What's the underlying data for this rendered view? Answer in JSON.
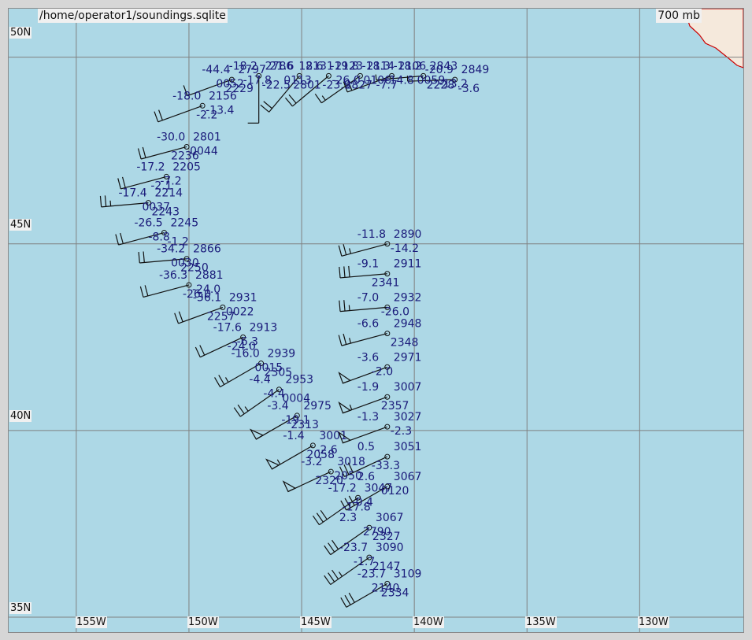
{
  "map": {
    "source_path": "/home/operator1/soundings.sqlite",
    "pressure_level": "700 mb",
    "colors": {
      "ocean": "#add8e6",
      "land": "#f5e9dc",
      "coast": "#cc0000",
      "grid": "#808080",
      "station_text": "#1a1a7a",
      "barb": "#111111"
    },
    "lat_labels": [
      "50N",
      "45N",
      "40N",
      "35N"
    ],
    "lon_labels": [
      "155W",
      "150W",
      "145W",
      "140W",
      "135W",
      "130W"
    ]
  },
  "chart_data": {
    "type": "scatter",
    "projection": "equirectangular",
    "lon_range": [
      -158,
      -125.4
    ],
    "lat_range": [
      34.6,
      51.3
    ],
    "grid": true,
    "lat_lines": [
      50,
      45,
      40,
      35
    ],
    "lon_lines": [
      -155,
      -150,
      -145,
      -140,
      -135,
      -130
    ],
    "stations": [
      {
        "lon": -146.9,
        "lat": 49.5,
        "temp": "-18.2",
        "hgt": "2786",
        "wind_dir": 180,
        "wind_kt": 10
      },
      {
        "lon": -145.1,
        "lat": 49.5,
        "temp": "21.6",
        "hgt": "2131",
        "wind_dir": 220,
        "wind_kt": 20
      },
      {
        "lon": -143.8,
        "lat": 49.5,
        "temp": "18.6",
        "hgt": "2123",
        "wind_dir": 230,
        "wind_kt": 20
      },
      {
        "lon": -142.4,
        "lat": 49.5,
        "temp": "-19.8",
        "hgt": "2114",
        "wind_dir": 235,
        "wind_kt": 15
      },
      {
        "lon": -141.0,
        "lat": 49.5,
        "temp": "-18.3",
        "hgt": "2106",
        "wind_dir": 250,
        "wind_kt": 15
      },
      {
        "lon": -139.6,
        "lat": 49.5,
        "temp": "-18.2",
        "hgt": "2843",
        "wind_dir": 265,
        "wind_kt": 5
      },
      {
        "lon": -138.2,
        "lat": 49.4,
        "temp": "-20.9",
        "hgt": "2849",
        "wind_dir": 268,
        "wind_kt": 5
      },
      {
        "lon": -148.1,
        "lat": 49.4,
        "temp": "-44.4",
        "hgt": "2797",
        "wind_dir": 250,
        "wind_kt": 10
      },
      {
        "lon": -149.4,
        "lat": 48.7,
        "temp": "-18.0",
        "hgt": "2156",
        "wind_dir": 250,
        "wind_kt": 20
      },
      {
        "lon": -150.1,
        "lat": 47.6,
        "temp": "-30.0",
        "hgt": "2801",
        "wind_dir": 255,
        "wind_kt": 20
      },
      {
        "lon": -151.0,
        "lat": 46.8,
        "temp": "-17.2",
        "hgt": "2205",
        "wind_dir": 255,
        "wind_kt": 20
      },
      {
        "lon": -151.8,
        "lat": 46.1,
        "temp": "-17.4",
        "hgt": "2214",
        "wind_dir": 265,
        "wind_kt": 25
      },
      {
        "lon": -151.1,
        "lat": 45.3,
        "temp": "-26.5",
        "hgt": "2245",
        "wind_dir": 255,
        "wind_kt": 20
      },
      {
        "lon": -150.1,
        "lat": 44.6,
        "temp": "-34.2",
        "hgt": "2866",
        "wind_dir": 265,
        "wind_kt": 20
      },
      {
        "lon": -150.0,
        "lat": 43.9,
        "temp": "-36.3",
        "hgt": "2881",
        "wind_dir": 255,
        "wind_kt": 20
      },
      {
        "lon": -148.5,
        "lat": 43.3,
        "temp": "-36.1",
        "hgt": "2931",
        "wind_dir": 250,
        "wind_kt": 20
      },
      {
        "lon": -147.6,
        "lat": 42.5,
        "temp": "-17.6",
        "hgt": "2913",
        "wind_dir": 245,
        "wind_kt": 20
      },
      {
        "lon": -146.8,
        "lat": 41.8,
        "temp": "-16.0",
        "hgt": "2939",
        "wind_dir": 240,
        "wind_kt": 25
      },
      {
        "lon": -146.0,
        "lat": 41.1,
        "temp": "-4.4",
        "hgt": "2953",
        "wind_dir": 235,
        "wind_kt": 25
      },
      {
        "lon": -145.2,
        "lat": 40.4,
        "temp": "-3.4",
        "hgt": "2975",
        "wind_dir": 240,
        "wind_kt": 50
      },
      {
        "lon": -144.5,
        "lat": 39.6,
        "temp": "-1.4",
        "hgt": "3001",
        "wind_dir": 240,
        "wind_kt": 55
      },
      {
        "lon": -143.7,
        "lat": 38.9,
        "temp": "-3.2",
        "hgt": "3018",
        "wind_dir": 245,
        "wind_kt": 50
      },
      {
        "lon": -142.5,
        "lat": 38.2,
        "temp": "-17.2",
        "hgt": "3047",
        "wind_dir": 235,
        "wind_kt": 30
      },
      {
        "lon": -142.0,
        "lat": 37.4,
        "temp": "2.3",
        "hgt": "3067",
        "wind_dir": 235,
        "wind_kt": 30
      },
      {
        "lon": -142.0,
        "lat": 36.6,
        "temp": "-23.7",
        "hgt": "3090",
        "wind_dir": 235,
        "wind_kt": 35
      },
      {
        "lon": -141.2,
        "lat": 35.9,
        "temp": "-23.7",
        "hgt": "3109",
        "wind_dir": 240,
        "wind_kt": 30
      },
      {
        "lon": -141.2,
        "lat": 45.0,
        "temp": "-11.8",
        "hgt": "2890",
        "wind_dir": 255,
        "wind_kt": 25
      },
      {
        "lon": -141.2,
        "lat": 44.2,
        "temp": "-9.1",
        "hgt": "2911",
        "wind_dir": 265,
        "wind_kt": 30
      },
      {
        "lon": -141.2,
        "lat": 43.3,
        "temp": "-7.0",
        "hgt": "2932",
        "wind_dir": 265,
        "wind_kt": 25
      },
      {
        "lon": -141.2,
        "lat": 42.6,
        "temp": "-6.6",
        "hgt": "2948",
        "wind_dir": 255,
        "wind_kt": 25
      },
      {
        "lon": -141.2,
        "lat": 41.7,
        "temp": "-3.6",
        "hgt": "2971",
        "wind_dir": 250,
        "wind_kt": 50
      },
      {
        "lon": -141.2,
        "lat": 40.9,
        "temp": "-1.9",
        "hgt": "3007",
        "wind_dir": 250,
        "wind_kt": 55
      },
      {
        "lon": -141.2,
        "lat": 40.1,
        "temp": "-1.3",
        "hgt": "3027",
        "wind_dir": 250,
        "wind_kt": 50
      },
      {
        "lon": -141.2,
        "lat": 39.3,
        "temp": "0.5",
        "hgt": "3051",
        "wind_dir": 245,
        "wind_kt": 30
      },
      {
        "lon": -141.2,
        "lat": 38.5,
        "temp": "2.6",
        "hgt": "3067",
        "wind_dir": 240,
        "wind_kt": 30
      }
    ],
    "extra_labels": [
      "-17.8",
      "2801",
      "-26.0",
      "2827",
      "-14.8",
      "2228",
      "-13.2",
      "2229",
      "-13.4",
      "2236",
      "-7.2",
      "2243",
      "-8.8",
      "2250",
      "-24.0",
      "2257",
      "-6.3",
      "2305",
      "-4.4",
      "2313",
      "-2.6",
      "2320",
      "-0.4",
      "2327",
      "-1.7",
      "2334",
      "-14.2",
      "2341",
      "-26.0",
      "2348",
      "-2.0",
      "2357",
      "-2.3",
      "-33.3",
      "0120",
      "-22.5",
      "0113",
      "-23.9",
      "0106",
      "-7.7",
      "0059",
      "-3.6",
      "0052",
      "-2.2",
      "0044",
      "-2.1",
      "0037",
      "-1.2",
      "0030",
      "-26.0",
      "0022",
      "-24.0",
      "0015",
      "0004",
      "-19.1",
      "2058",
      "2050",
      "-17.8",
      "2790",
      "2147",
      "2140"
    ]
  }
}
